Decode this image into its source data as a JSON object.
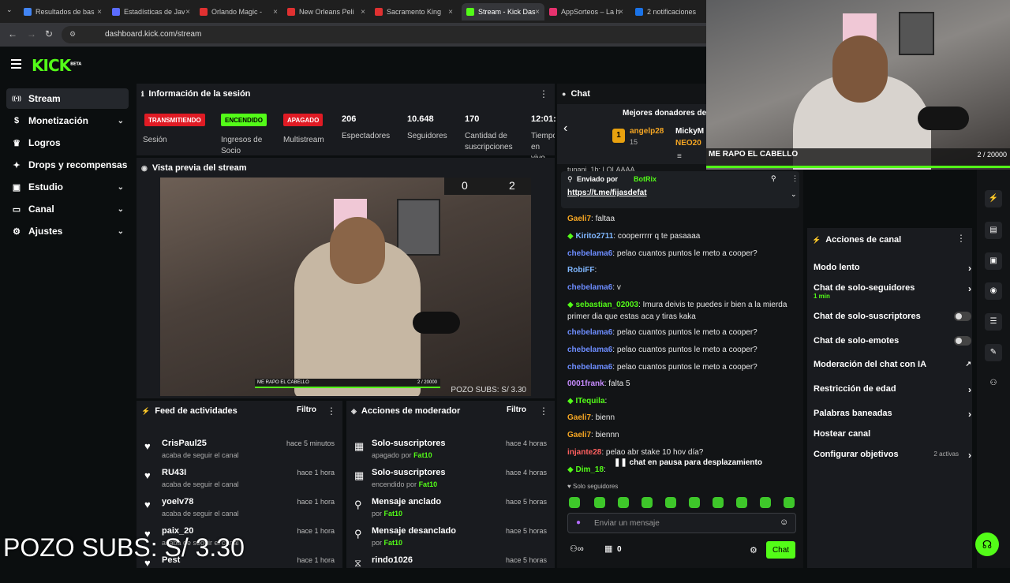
{
  "browser": {
    "tabs": [
      {
        "label": "Resultados de bas",
        "color": "#4285f4"
      },
      {
        "label": "Estadísticas de Jav",
        "color": "#5b6cff"
      },
      {
        "label": "Orlando Magic -",
        "color": "#e03131"
      },
      {
        "label": "New Orleans Peli",
        "color": "#e03131"
      },
      {
        "label": "Sacramento King",
        "color": "#e03131"
      },
      {
        "label": "Stream - Kick Das",
        "color": "#53fc18"
      },
      {
        "label": "AppSorteos – La h",
        "color": "#e6326e"
      },
      {
        "label": "2 notificaciones",
        "color": "#1a73e8"
      }
    ],
    "url": "dashboard.kick.com/stream"
  },
  "app": {
    "logo": "KICK",
    "logo_sup": "BETA"
  },
  "sidebar": {
    "items": [
      {
        "label": "Stream",
        "icon": "broadcast-icon"
      },
      {
        "label": "Monetización",
        "icon": "money-icon"
      },
      {
        "label": "Logros",
        "icon": "trophy-icon"
      },
      {
        "label": "Drops y recompensas",
        "icon": "gift-icon"
      },
      {
        "label": "Estudio",
        "icon": "studio-icon"
      },
      {
        "label": "Canal",
        "icon": "tv-icon"
      },
      {
        "label": "Ajustes",
        "icon": "gear-icon"
      }
    ]
  },
  "session": {
    "title": "Información de la sesión",
    "badges": [
      {
        "label": "TRANSMITIENDO",
        "color": "#e01b24"
      },
      {
        "label": "ENCENDIDO",
        "color": "#53fc18"
      },
      {
        "label": "APAGADO",
        "color": "#e01b24"
      }
    ],
    "badge_labels": [
      "Sesión",
      "Ingresos de Socio",
      "Multistream"
    ],
    "stats": [
      {
        "value": "206",
        "label": "Espectadores"
      },
      {
        "value": "10.648",
        "label": "Seguidores"
      },
      {
        "value": "170",
        "label": "Cantidad de suscripciones"
      },
      {
        "value": "12:01:",
        "label": "Tiempo en vivo"
      }
    ]
  },
  "preview": {
    "title": "Vista previa del stream",
    "score_left": "0",
    "score_right": "2",
    "banner": "ME RAPO EL CABELLO",
    "banner_counter": "2 / 20000",
    "pozo": "POZO SUBS: S/ 3.30"
  },
  "feed": {
    "title": "Feed de actividades",
    "filter": "Filtro",
    "items": [
      {
        "name": "CrisPaul25",
        "sub": "acaba de seguir el canal",
        "time": "hace 5 minutos"
      },
      {
        "name": "RU43I",
        "sub": "acaba de seguir el canal",
        "time": "hace 1 hora"
      },
      {
        "name": "yoelv78",
        "sub": "acaba de seguir el canal",
        "time": "hace 1 hora"
      },
      {
        "name": "paix_20",
        "sub": "acaba de seguir el canal",
        "time": "hace 1 hora"
      },
      {
        "name": "Pest",
        "sub": "",
        "time": "hace 1 hora"
      }
    ]
  },
  "mod": {
    "title": "Acciones de moderador",
    "filter": "Filtro",
    "items": [
      {
        "title": "Solo-suscriptores",
        "sub": "apagado por",
        "user": "Fat10",
        "time": "hace 4 horas"
      },
      {
        "title": "Solo-suscriptores",
        "sub": "encendido por",
        "user": "Fat10",
        "time": "hace 4 horas"
      },
      {
        "title": "Mensaje anclado",
        "sub": "por",
        "user": "Fat10",
        "time": "hace 5 horas"
      },
      {
        "title": "Mensaje desanclado",
        "sub": "por",
        "user": "Fat10",
        "time": "hace 5 horas"
      },
      {
        "title": "rindo1026",
        "sub": "",
        "user": "",
        "time": "hace 5 horas"
      }
    ]
  },
  "chat": {
    "title": "Chat",
    "donors_title": "Mejores donadores de l",
    "donor1": "angelp28",
    "donor1_count": "15",
    "donor2": "MickyM",
    "donor3": "NEO20",
    "top_line": "tunani_1b: LOLAAAA",
    "pinned_by_label": "Enviado por",
    "pinned_by": "BotRix",
    "pinned_link": "https://t.me/fijasdefat",
    "messages": [
      {
        "user": "Gaeli7",
        "cls": "u-orange",
        "text": ": faltaa"
      },
      {
        "user": "Kirito2711",
        "cls": "u-lblue",
        "text": ": cooperrrrr q te pasaaaa"
      },
      {
        "user": "chebelama6",
        "cls": "u-blue",
        "text": ": pelao cuantos puntos le meto a cooper?"
      },
      {
        "user": "RobiFF",
        "cls": "u-lblue",
        "text": ":"
      },
      {
        "user": "chebelama6",
        "cls": "u-blue",
        "text": ": v"
      },
      {
        "user": "sebastian_02003",
        "cls": "u-green",
        "text": ": Imura deivis te puedes ir bien a la mierda primer dia que estas aca y tiras kaka"
      },
      {
        "user": "chebelama6",
        "cls": "u-blue",
        "text": ": pelao cuantos puntos le meto a cooper?"
      },
      {
        "user": "chebelama6",
        "cls": "u-blue",
        "text": ": pelao cuantos puntos le meto a cooper?"
      },
      {
        "user": "chebelama6",
        "cls": "u-blue",
        "text": ": pelao cuantos puntos le meto a cooper?"
      },
      {
        "user": "0001frank",
        "cls": "u-purple",
        "text": ": falta 5"
      },
      {
        "user": "ITequila",
        "cls": "u-green",
        "text": ":"
      },
      {
        "user": "Gaeli7",
        "cls": "u-orange",
        "text": ": bienn"
      },
      {
        "user": "Gaeli7",
        "cls": "u-orange",
        "text": ": biennn"
      },
      {
        "user": "injante28",
        "cls": "u-red",
        "text": ": pelao abr stake 10 hov día?"
      },
      {
        "user": "Dim_18",
        "cls": "u-green",
        "text": ":"
      }
    ],
    "paused": "chat en pausa para desplazamiento",
    "followers_only": "Solo seguidores",
    "input_placeholder": "Enviar un mensaje",
    "count": "0",
    "send": "Chat"
  },
  "channel_actions": {
    "title": "Acciones de canal",
    "items": [
      {
        "label": "Modo lento",
        "sub": "",
        "control": "chevron"
      },
      {
        "label": "Chat de solo-seguidores",
        "sub": "1 min",
        "control": "chevron"
      },
      {
        "label": "Chat de solo-suscriptores",
        "sub": "",
        "control": "toggle"
      },
      {
        "label": "Chat de solo-emotes",
        "sub": "",
        "control": "toggle"
      },
      {
        "label": "Moderación del chat con IA",
        "sub": "",
        "control": "external"
      },
      {
        "label": "Restricción de edad",
        "sub": "",
        "control": "chevron"
      },
      {
        "label": "Palabras baneadas",
        "sub": "",
        "control": "chevron"
      },
      {
        "label": "Hostear canal",
        "sub": "",
        "control": "none"
      },
      {
        "label": "Configurar objetivos",
        "sub": "",
        "control": "chevron",
        "extra": "2 activas"
      }
    ]
  },
  "webcam": {
    "banner": "ME RAPO EL CABELLO",
    "counter": "2 / 20000"
  },
  "overlay_text": "POZO SUBS: S/ 3.30",
  "colors": {
    "accent": "#53fc18",
    "live": "#e01b24"
  }
}
